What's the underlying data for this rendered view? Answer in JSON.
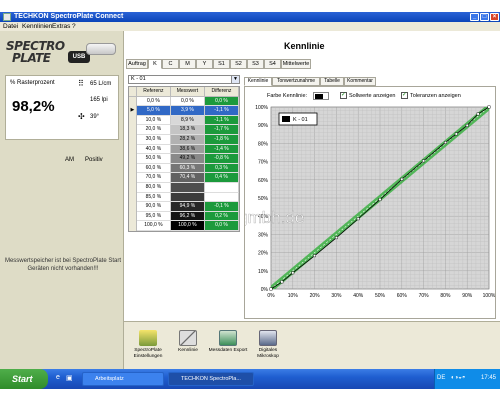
{
  "window": {
    "title": "TECHKON SpectroPlate Connect"
  },
  "menu": {
    "items": [
      "Datei",
      "Kennlinien",
      "Extras",
      "?"
    ]
  },
  "left": {
    "logo_top": "SPECTRO",
    "logo_bottom": "PLATE",
    "usb_badge": "USB",
    "measure_label": "% Rasterprozent",
    "measure_value": "98,2%",
    "lpcm": "65 L/cm",
    "lpi": "165 lpi",
    "angle": "39°",
    "footer_am": "AM",
    "footer_pos": "Positiv",
    "message": "Messwertspeicher ist bei SpectroPlate Start Geräten nicht vorhanden!!!"
  },
  "main": {
    "title": "Kennlinie",
    "tabs": [
      "Auftrag",
      "K",
      "C",
      "M",
      "Y",
      "S1",
      "S2",
      "S3",
      "S4",
      "Mittelwerte"
    ],
    "active_tab": "K",
    "dropdown_value": "K - 01",
    "table": {
      "headers": [
        "Referenz",
        "Messwert",
        "Differenz"
      ],
      "rows": [
        [
          "0,0 %",
          "0,0 %",
          "0,0 %"
        ],
        [
          "5,0 %",
          "3,9 %",
          "-1,1 %"
        ],
        [
          "10,0 %",
          "8,9 %",
          "-1,1 %"
        ],
        [
          "20,0 %",
          "18,3 %",
          "-1,7 %"
        ],
        [
          "30,0 %",
          "28,2 %",
          "-1,8 %"
        ],
        [
          "40,0 %",
          "38,6 %",
          "-1,4 %"
        ],
        [
          "50,0 %",
          "49,2 %",
          "-0,8 %"
        ],
        [
          "60,0 %",
          "60,3 %",
          "0,3 %"
        ],
        [
          "70,0 %",
          "70,4 %",
          "0,4 %"
        ],
        [
          "80,0 %",
          "",
          ""
        ],
        [
          "85,0 %",
          "",
          ""
        ],
        [
          "90,0 %",
          "94,9 %",
          "-0,1 %"
        ],
        [
          "95,0 %",
          "96,2 %",
          "0,2 %"
        ],
        [
          "100,0 %",
          "100,0 %",
          "0,0 %"
        ]
      ],
      "selected_row": 1
    },
    "chart_tabs": [
      "Kennlinie",
      "Tonwertzunahme",
      "Tabelle",
      "Kommentar"
    ],
    "active_chart_tab": "Kennlinie",
    "farbe_label": "Farbe Kennlinie:",
    "soll_label": "Sollwerte anzeigen",
    "tol_label": "Toleranzen anzeigen",
    "legend_label": "K - 01"
  },
  "chart_data": {
    "type": "line",
    "title": "",
    "xlabel": "",
    "ylabel": "",
    "xlim": [
      0,
      100
    ],
    "ylim": [
      0,
      100
    ],
    "x_ticks": [
      "0%",
      "10%",
      "20%",
      "30%",
      "40%",
      "50%",
      "60%",
      "70%",
      "80%",
      "90%",
      "100%"
    ],
    "y_ticks": [
      "0%",
      "10%",
      "20%",
      "30%",
      "40%",
      "50%",
      "60%",
      "70%",
      "80%",
      "90%",
      "100%"
    ],
    "grid": true,
    "legend_position": "top-left",
    "series": [
      {
        "name": "K - 01",
        "color": "#000000",
        "x": [
          0,
          5,
          10,
          20,
          30,
          40,
          50,
          60,
          70,
          80,
          85,
          90,
          95,
          100
        ],
        "y": [
          0,
          3.9,
          8.9,
          18.3,
          28.2,
          38.6,
          49.2,
          60.3,
          70.4,
          80.5,
          85.2,
          89.9,
          96.2,
          100
        ]
      }
    ],
    "tolerance_band": {
      "color": "#3cb043",
      "width_pct": 2
    }
  },
  "colors": {
    "tol_green": "#3cb043",
    "selected_blue": "#3169c6",
    "diff_green": "#1c9a3c"
  },
  "toolbar": {
    "items": [
      "SpectroPlate Einstellungen",
      "Kennlinie",
      "Messdaten Export",
      "Digitales Mikroskop"
    ]
  },
  "taskbar": {
    "start": "Start",
    "items": [
      "Arbeitsplatz",
      "TECHKON SpectroPla..."
    ],
    "tray_lang": "DE",
    "clock": "17:45"
  },
  "watermark": "www.3p-gmbh.de"
}
